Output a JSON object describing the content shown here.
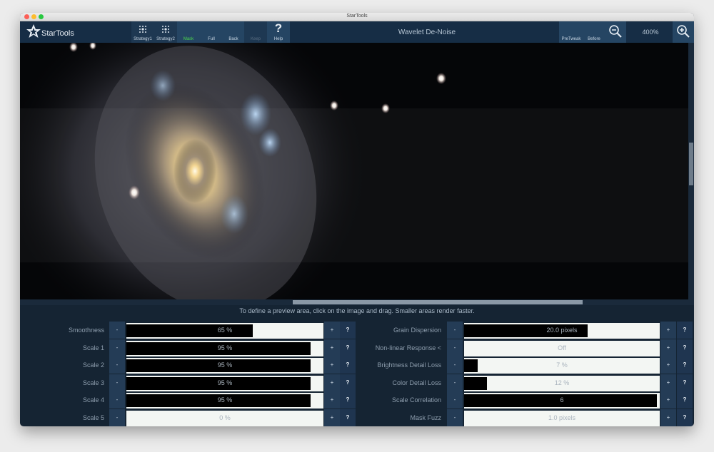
{
  "window": {
    "title": "StarTools"
  },
  "toolbar": {
    "logo": "StarTools",
    "buttons": [
      "Strategy1",
      "Strategy2",
      "Mask",
      "Full",
      "Back",
      "Keep",
      "Help"
    ],
    "tool_title": "Wavelet De-Noise",
    "right_buttons": [
      "PreTweak",
      "Before"
    ],
    "zoom_level": "400%"
  },
  "hint": "To define a preview area, click on the image and drag. Smaller areas render faster.",
  "params_left": [
    {
      "label": "Smoothness",
      "value": "65 %",
      "fill": 0.65
    },
    {
      "label": "Scale 1",
      "value": "95 %",
      "fill": 0.95
    },
    {
      "label": "Scale 2",
      "value": "95 %",
      "fill": 0.95
    },
    {
      "label": "Scale 3",
      "value": "95 %",
      "fill": 0.95
    },
    {
      "label": "Scale 4",
      "value": "95 %",
      "fill": 0.95
    },
    {
      "label": "Scale 5",
      "value": "0 %",
      "fill": 0.0
    }
  ],
  "params_right": [
    {
      "label": "Grain Dispersion",
      "value": "20.0 pixels",
      "fill": 0.64
    },
    {
      "label": "Non-linear Response <",
      "value": "Off",
      "fill": 0.0
    },
    {
      "label": "Brightness Detail Loss",
      "value": "7 %",
      "fill": 0.07
    },
    {
      "label": "Color Detail Loss",
      "value": "12 %",
      "fill": 0.12
    },
    {
      "label": "Scale Correlation",
      "value": "6",
      "fill": 1.0
    },
    {
      "label": "Mask Fuzz",
      "value": "1.0 pixels",
      "fill": 0.0
    }
  ],
  "controls": {
    "minus": "-",
    "plus": "+",
    "help": "?"
  },
  "colors": {
    "mask_active": "#4cd94c",
    "toolbar": "#162d45",
    "panel": "#152433"
  }
}
